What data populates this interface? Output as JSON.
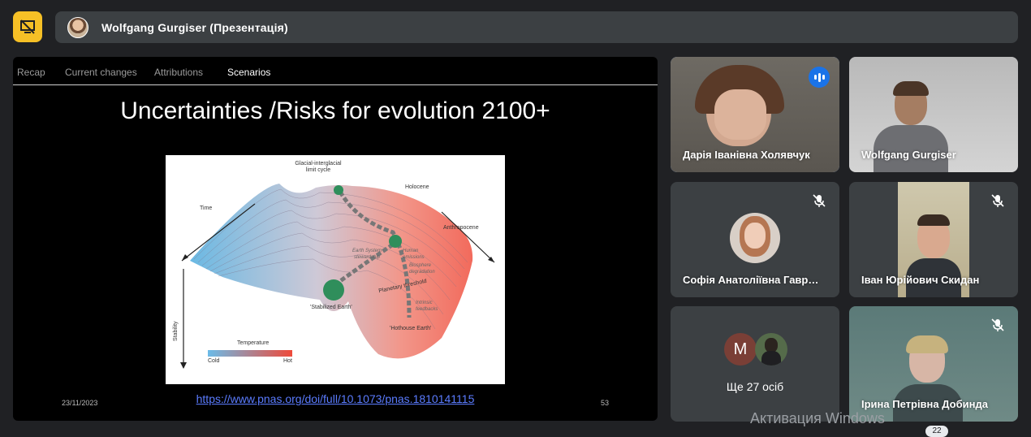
{
  "presenter_bar": {
    "title": "Wolfgang Gurgiser (Презентація)",
    "icon": "presentation-off-icon"
  },
  "slide": {
    "tabs": [
      "Recap",
      "Current changes",
      "Attributions",
      "Scenarios"
    ],
    "active_tab": "Scenarios",
    "title": "Uncertainties /Risks for evolution 2100+",
    "figure": {
      "labels": {
        "glacial": "Glacial-interglacial\nlimit cycle",
        "holocene": "Holocene",
        "time": "Time",
        "anthropocene": "Anthropocene",
        "stability": "Stability",
        "stabilized": "'Stabilized Earth'",
        "hothouse": "'Hothouse Earth'",
        "planetary": "Planetary threshold",
        "temperature": "Temperature",
        "cold": "Cold",
        "hot": "Hot",
        "stewardship": "Earth System\nstewardship",
        "human": "Human\nemissions",
        "biosphere": "Biosphere\ndegradation",
        "feedbacks": "Intrinsic\nfeedbacks"
      }
    },
    "date": "23/11/2023",
    "link": "https://www.pnas.org/doi/full/10.1073/pnas.1810141115",
    "page_number": "53"
  },
  "participants": [
    {
      "name": "Дарія Іванівна Холявчук",
      "speaking": true
    },
    {
      "name": "Wolfgang Gurgiser",
      "muted": false
    },
    {
      "name": "Софія Анатоліївна Гавр…",
      "muted": true
    },
    {
      "name": "Іван Юрійович Скидан",
      "muted": true
    },
    {
      "more_label": "Ще 27 осіб",
      "avatar_letter": "M"
    },
    {
      "name": "Ірина Петрівна Добинда",
      "muted": true
    }
  ],
  "watermark": "Активация Windows",
  "badge": "22"
}
